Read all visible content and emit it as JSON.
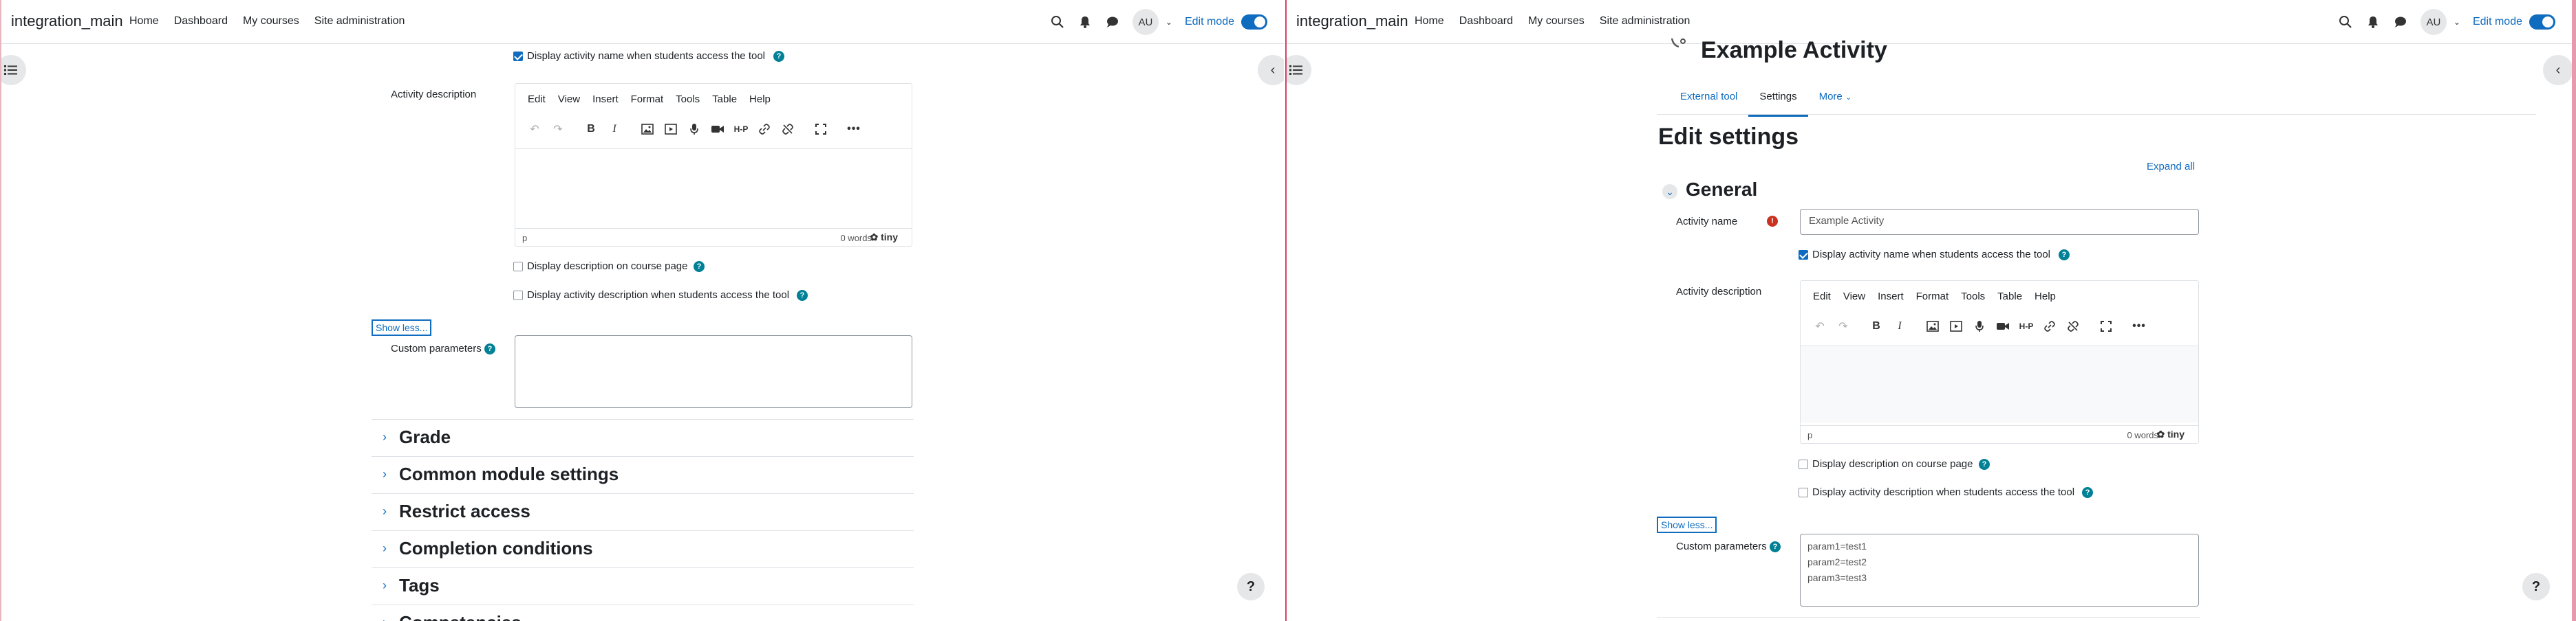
{
  "navbar": {
    "brand": "integration_main",
    "links": [
      "Home",
      "Dashboard",
      "My courses",
      "Site administration"
    ],
    "avatar_initials": "AU",
    "edit_mode_label": "Edit mode",
    "edit_mode_on": true
  },
  "editor": {
    "menu": [
      "Edit",
      "View",
      "Insert",
      "Format",
      "Tools",
      "Table",
      "Help"
    ],
    "status_path": "p",
    "word_count": "0 words",
    "brand": "tiny"
  },
  "left": {
    "display_name_checkbox": {
      "label": "Display activity name when students access the tool",
      "checked": true
    },
    "activity_description_label": "Activity description",
    "display_on_course_page": {
      "label": "Display description on course page",
      "checked": false
    },
    "display_desc_when_access": {
      "label": "Display activity description when students access the tool",
      "checked": false
    },
    "show_less": "Show less...",
    "custom_parameters_label": "Custom parameters",
    "custom_parameters_value": "",
    "sections": [
      "Grade",
      "Common module settings",
      "Restrict access",
      "Completion conditions",
      "Tags",
      "Competencies"
    ]
  },
  "right": {
    "page_heading": "Example Activity",
    "tabs": [
      "External tool",
      "Settings",
      "More"
    ],
    "active_tab": "Settings",
    "edit_settings_title": "Edit settings",
    "expand_all": "Expand all",
    "general_title": "General",
    "activity_name_label": "Activity name",
    "activity_name_value": "Example Activity",
    "display_name_checkbox": {
      "label": "Display activity name when students access the tool",
      "checked": true
    },
    "activity_description_label": "Activity description",
    "display_on_course_page": {
      "label": "Display description on course page",
      "checked": false
    },
    "display_desc_when_access": {
      "label": "Display activity description when students access the tool",
      "checked": false
    },
    "show_less": "Show less...",
    "custom_parameters_label": "Custom parameters",
    "custom_parameters_lines": [
      "param1=test1",
      "param2=test2",
      "param3=test3"
    ]
  },
  "colors": {
    "primary": "#0f6cbf",
    "help": "#008196",
    "required": "#ca3120"
  }
}
